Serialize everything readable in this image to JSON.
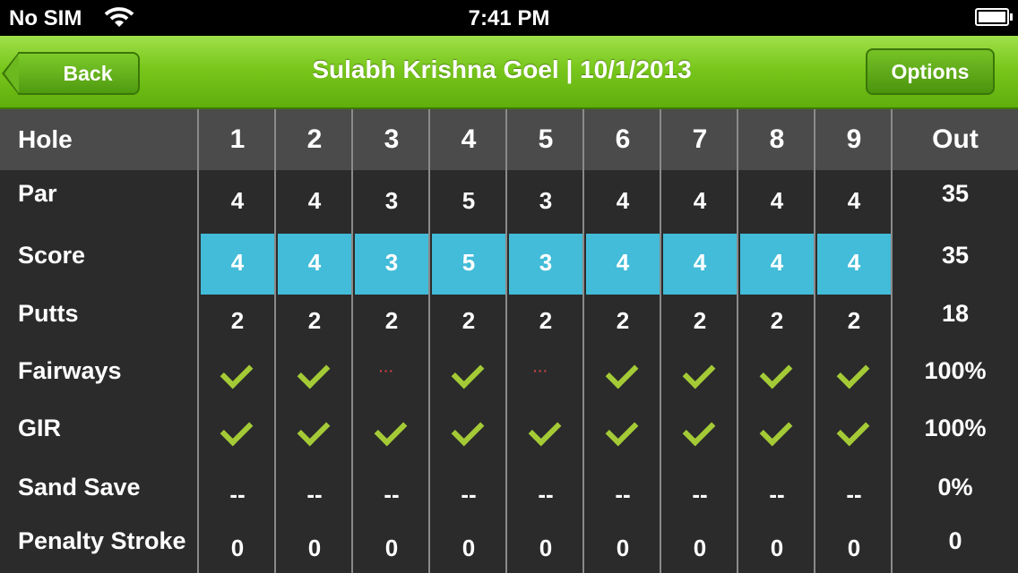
{
  "status_bar": {
    "carrier": "No SIM",
    "time": "7:41 PM"
  },
  "nav": {
    "title": "Sulabh Krishna Goel | 10/1/2013",
    "back_label": "Back",
    "options_label": "Options"
  },
  "colors": {
    "nav_green": "#79c71c",
    "score_highlight": "#42bcd8",
    "check_green": "#a4cb36",
    "miss_red": "#dd4444"
  },
  "scorecard": {
    "header": {
      "label": "Hole",
      "holes": [
        "1",
        "2",
        "3",
        "4",
        "5",
        "6",
        "7",
        "8",
        "9"
      ],
      "total": "Out"
    },
    "rows": [
      {
        "label": "Par",
        "values": [
          "4",
          "4",
          "3",
          "5",
          "3",
          "4",
          "4",
          "4",
          "4"
        ],
        "total": "35"
      },
      {
        "label": "Score",
        "values": [
          "4",
          "4",
          "3",
          "5",
          "3",
          "4",
          "4",
          "4",
          "4"
        ],
        "total": "35"
      },
      {
        "label": "Putts",
        "values": [
          "2",
          "2",
          "2",
          "2",
          "2",
          "2",
          "2",
          "2",
          "2"
        ],
        "total": "18"
      },
      {
        "label": "Fairways",
        "values": [
          "check",
          "check",
          "miss",
          "check",
          "miss",
          "check",
          "check",
          "check",
          "check"
        ],
        "total": "100%"
      },
      {
        "label": "GIR",
        "values": [
          "check",
          "check",
          "check",
          "check",
          "check",
          "check",
          "check",
          "check",
          "check"
        ],
        "total": "100%"
      },
      {
        "label": "Sand Save",
        "values": [
          "--",
          "--",
          "--",
          "--",
          "--",
          "--",
          "--",
          "--",
          "--"
        ],
        "total": "0%"
      },
      {
        "label": "Penalty Stroke",
        "values": [
          "0",
          "0",
          "0",
          "0",
          "0",
          "0",
          "0",
          "0",
          "0"
        ],
        "total": "0"
      }
    ],
    "miss_marker": "···"
  }
}
